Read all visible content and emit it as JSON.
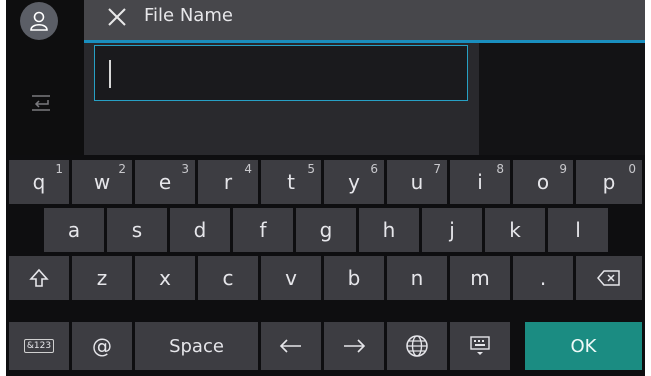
{
  "header": {
    "title": "File Name"
  },
  "field": {
    "value": ""
  },
  "keyboard": {
    "row1": [
      {
        "label": "q",
        "num": "1"
      },
      {
        "label": "w",
        "num": "2"
      },
      {
        "label": "e",
        "num": "3"
      },
      {
        "label": "r",
        "num": "4"
      },
      {
        "label": "t",
        "num": "5"
      },
      {
        "label": "y",
        "num": "6"
      },
      {
        "label": "u",
        "num": "7"
      },
      {
        "label": "i",
        "num": "8"
      },
      {
        "label": "o",
        "num": "9"
      },
      {
        "label": "p",
        "num": "0"
      }
    ],
    "row2": [
      "a",
      "s",
      "d",
      "f",
      "g",
      "h",
      "j",
      "k",
      "l"
    ],
    "row3": [
      "z",
      "x",
      "c",
      "v",
      "b",
      "n",
      "m",
      "."
    ],
    "row4": {
      "sym": "&123",
      "at": "@",
      "space": "Space",
      "ok": "OK"
    }
  }
}
